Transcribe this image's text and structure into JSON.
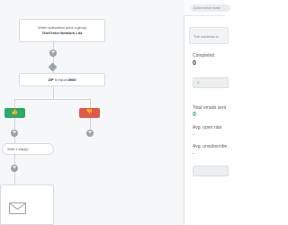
{
  "toolbar": {
    "status_label": "Automation stats"
  },
  "notice": {
    "text": "The workflow is"
  },
  "trigger": {
    "line1": "When subscriber joins a group",
    "line2": "TestTester Network List"
  },
  "condition": {
    "prefix": "ZIP",
    "middle": " is equal ",
    "value": "8080"
  },
  "wait": {
    "label": "Wait 1 day(s)"
  },
  "branches": {
    "yes_icon": "thumbs-up-icon",
    "no_icon": "thumbs-down-icon"
  },
  "stats": {
    "completed_label": "Completed",
    "completed_value": "0",
    "view_button": "V",
    "total_sent_label": "Total emails sent",
    "total_sent_value": "0",
    "open_rate_label": "Avg. open rate",
    "open_rate_value": "-",
    "unsubscribe_label": "Avg. unsubscribe",
    "unsubscribe_value": "-"
  },
  "colors": {
    "yes_branch": "#2fa86a",
    "no_branch": "#e05a4c",
    "accent": "#2fa86a"
  }
}
